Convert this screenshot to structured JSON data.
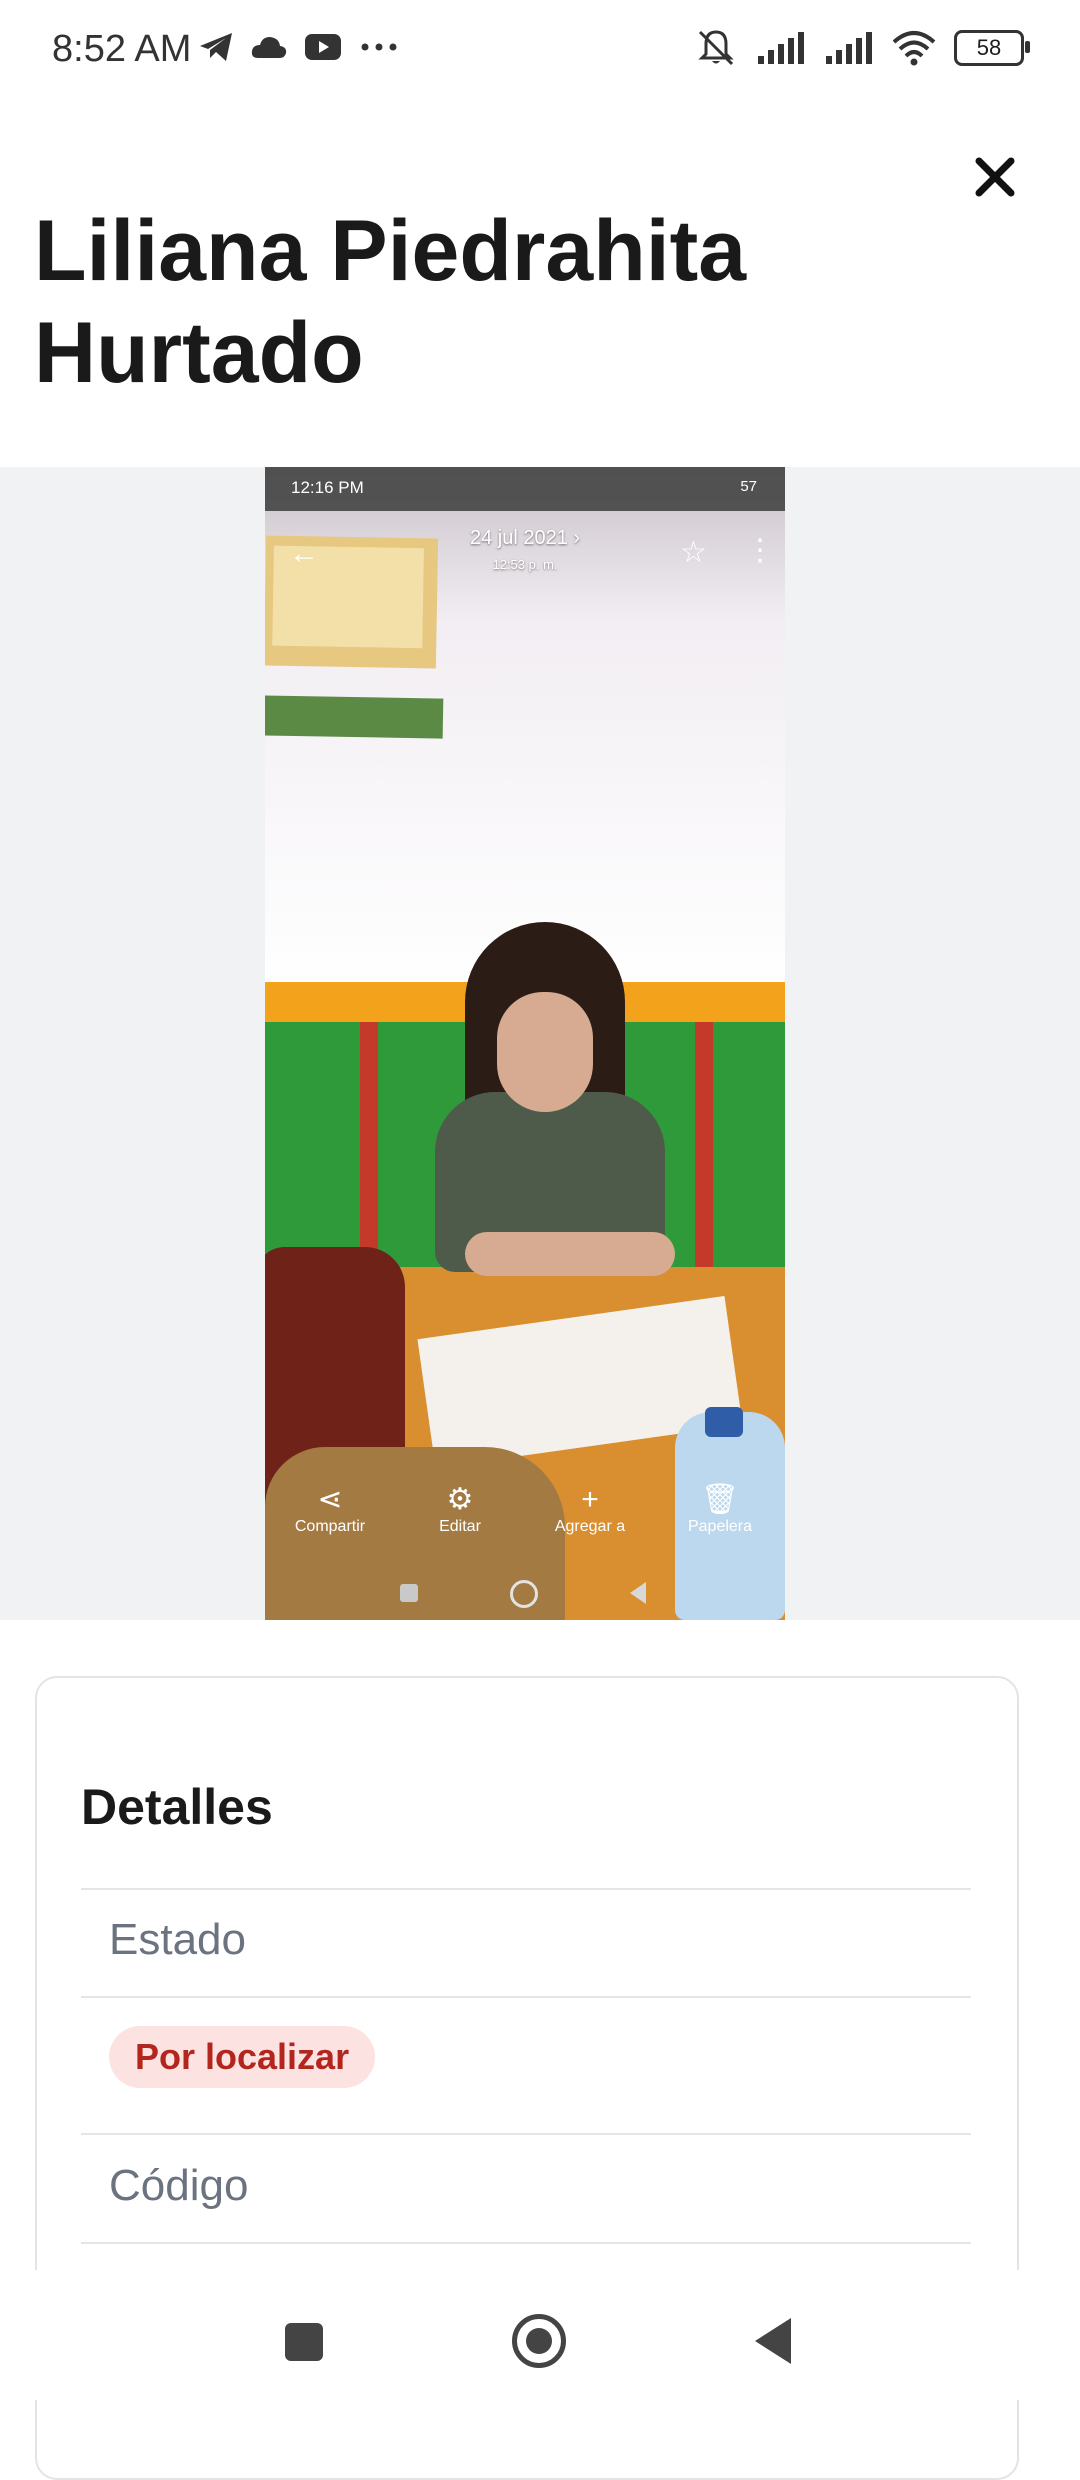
{
  "status_bar": {
    "time": "8:52 AM",
    "battery": "58",
    "left_icons": [
      "telegram-icon",
      "cloud-icon",
      "youtube-icon",
      "more-dots-icon"
    ],
    "right_icons": [
      "mute-icon",
      "signal-icon",
      "signal-icon",
      "wifi-icon",
      "battery-icon"
    ]
  },
  "header": {
    "title": "Liliana Piedrahita Hurtado",
    "close_icon": "close-icon"
  },
  "photo": {
    "inner_status_time": "12:16 PM",
    "inner_status_battery": "57",
    "inner_date": "24 jul 2021 ›",
    "inner_time": "12:53 p. m.",
    "actions": [
      {
        "icon": "share-icon",
        "label": "Compartir"
      },
      {
        "icon": "edit-icon",
        "label": "Editar"
      },
      {
        "icon": "plus-icon",
        "label": "Agregar a"
      },
      {
        "icon": "trash-icon",
        "label": "Papelera"
      }
    ]
  },
  "details": {
    "title": "Detalles",
    "estado_label": "Estado",
    "estado_value": "Por localizar",
    "codigo_label": "Código",
    "badge_bg": "#fde2e2",
    "badge_color": "#b3261e"
  },
  "nav": {
    "icons": [
      "recents-square-icon",
      "home-circle-icon",
      "back-triangle-icon"
    ]
  }
}
